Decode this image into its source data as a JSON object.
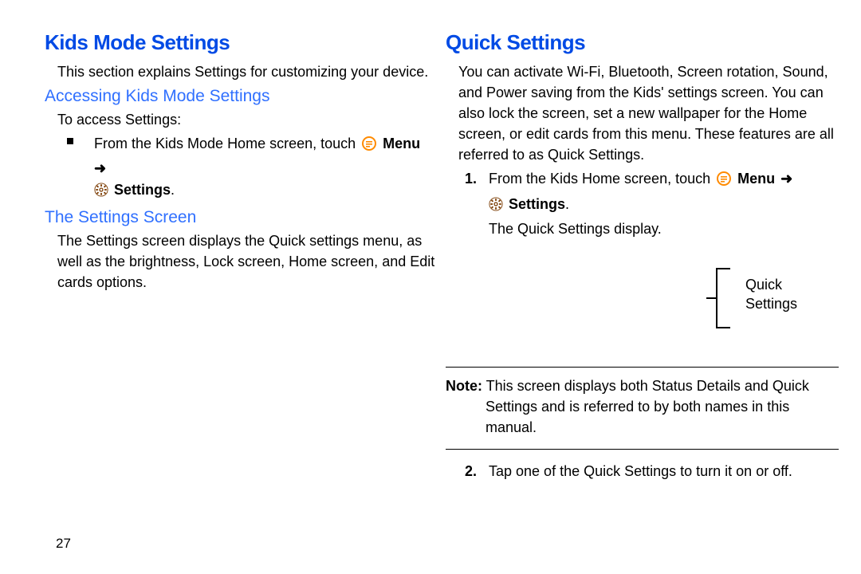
{
  "pageNumber": "27",
  "left": {
    "heading": "Kids Mode Settings",
    "intro": "This section explains Settings for customizing your device.",
    "sub1": "Accessing Kids Mode Settings",
    "access_lead": "To access Settings:",
    "bullet_pre": "From the Kids Mode Home screen, touch ",
    "menu_word": "Menu",
    "arrow": " ➜",
    "settings_word": "Settings",
    "period": ".",
    "sub2": "The Settings Screen",
    "screen_para": "The Settings screen displays the Quick settings menu, as well as the brightness, Lock screen, Home screen, and Edit cards options."
  },
  "right": {
    "heading": "Quick Settings",
    "para": "You can activate Wi-Fi, Bluetooth, Screen rotation, Sound, and Power saving from the Kids' settings screen. You can also lock the screen, set a new wallpaper for the Home screen, or edit cards from this menu. These features are all referred to as Quick Settings.",
    "step1_pre": "From the Kids Home screen, touch ",
    "step1_menu": "Menu",
    "step1_arrow": " ➜",
    "step1_settings": "Settings",
    "step1_period": ".",
    "step1_after": "The Quick Settings display.",
    "callout_l1": "Quick",
    "callout_l2": "Settings",
    "note_label": "Note:",
    "note_body": " This screen displays both Status Details and Quick Settings and is referred to by both names in this manual.",
    "step2_num": "2.",
    "step1_num": "1.",
    "step2": "Tap one of the Quick Settings to turn it on or off."
  }
}
